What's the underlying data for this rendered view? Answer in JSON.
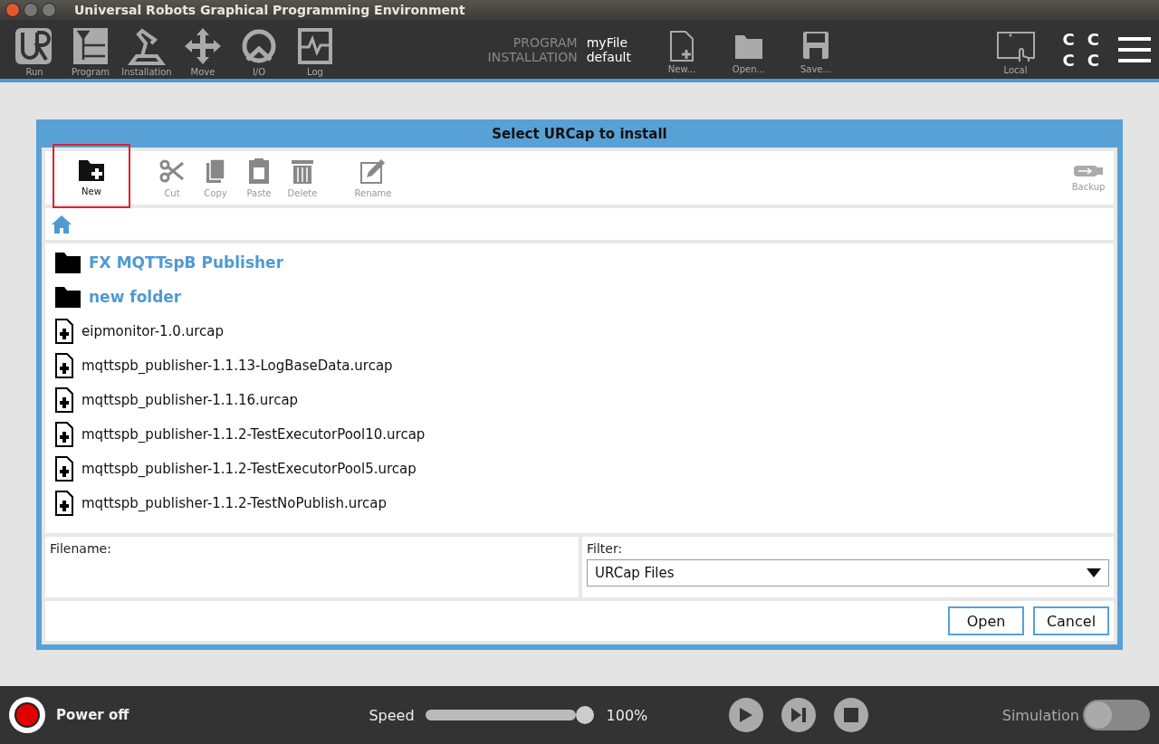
{
  "window": {
    "title": "Universal Robots Graphical Programming Environment"
  },
  "nav": [
    {
      "label": "Run"
    },
    {
      "label": "Program"
    },
    {
      "label": "Installation"
    },
    {
      "label": "Move"
    },
    {
      "label": "I/O"
    },
    {
      "label": "Log"
    }
  ],
  "program": {
    "program_label": "PROGRAM",
    "program_value": "myFile",
    "installation_label": "INSTALLATION",
    "installation_value": "default"
  },
  "file_actions": [
    {
      "label": "New..."
    },
    {
      "label": "Open..."
    },
    {
      "label": "Save..."
    }
  ],
  "local": {
    "label": "Local"
  },
  "status_letters": [
    "C",
    "C",
    "C",
    "C"
  ],
  "dialog": {
    "title": "Select URCap to install",
    "toolbar": [
      {
        "label": "New",
        "disabled": false,
        "highlighted": true
      },
      {
        "label": "Cut",
        "disabled": true,
        "highlighted": false
      },
      {
        "label": "Copy",
        "disabled": true,
        "highlighted": false
      },
      {
        "label": "Paste",
        "disabled": true,
        "highlighted": false
      },
      {
        "label": "Delete",
        "disabled": true,
        "highlighted": false
      },
      {
        "label": "Rename",
        "disabled": true,
        "highlighted": false
      }
    ],
    "backup": {
      "label": "Backup"
    },
    "files": [
      {
        "name": "FX MQTTspB Publisher",
        "kind": "folder"
      },
      {
        "name": "new folder",
        "kind": "folder"
      },
      {
        "name": "eipmonitor-1.0.urcap",
        "kind": "file"
      },
      {
        "name": "mqttspb_publisher-1.1.13-LogBaseData.urcap",
        "kind": "file"
      },
      {
        "name": "mqttspb_publisher-1.1.16.urcap",
        "kind": "file"
      },
      {
        "name": "mqttspb_publisher-1.1.2-TestExecutorPool10.urcap",
        "kind": "file"
      },
      {
        "name": "mqttspb_publisher-1.1.2-TestExecutorPool5.urcap",
        "kind": "file"
      },
      {
        "name": "mqttspb_publisher-1.1.2-TestNoPublish.urcap",
        "kind": "file"
      }
    ],
    "filename_label": "Filename:",
    "filter_label": "Filter:",
    "filter_value": "URCap Files",
    "buttons": [
      "Open",
      "Cancel"
    ]
  },
  "footer": {
    "power": "Power off",
    "speed_label": "Speed",
    "speed": {
      "level": 1.0
    },
    "speed_reading": "100%",
    "simulation_label": "Simulation",
    "simulation_on": false
  }
}
